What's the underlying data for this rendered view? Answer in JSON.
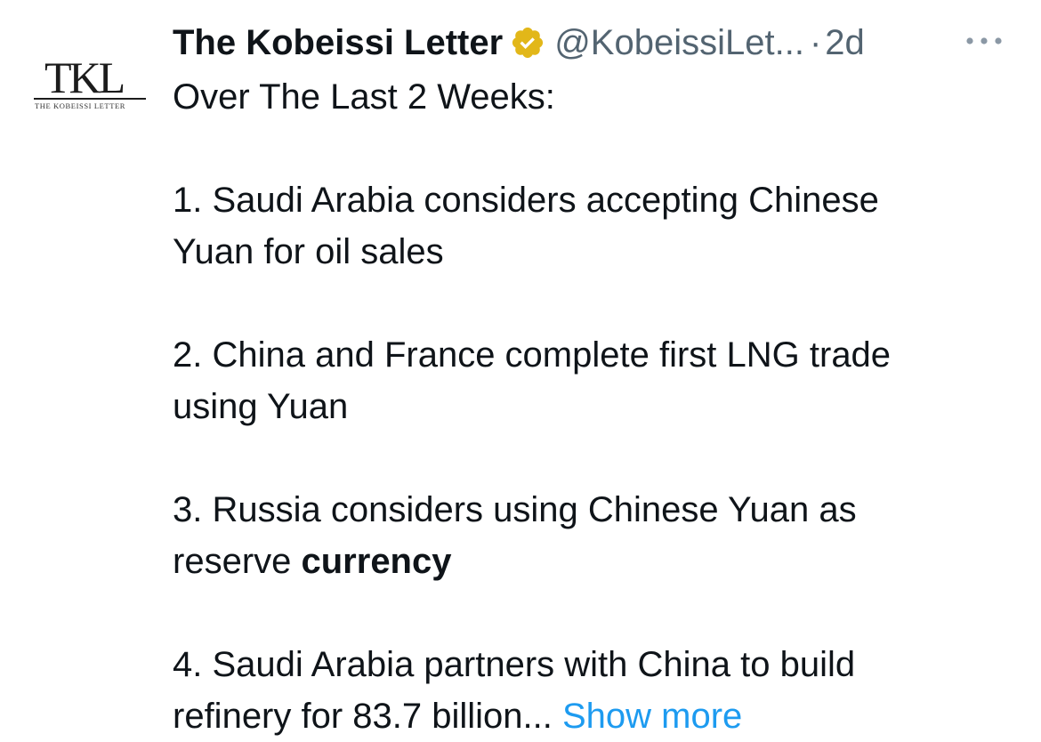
{
  "author": {
    "name": "The Kobeissi Letter",
    "handle": "@KobeissiLet...",
    "separator": "·",
    "time": "2d",
    "verified_badge_color": "#e2b719",
    "avatar": {
      "monogram": "TKL",
      "caption": "THE KOBEISSI LETTER"
    }
  },
  "more_icon": "more-horizontal-icon",
  "body": {
    "intro": "Over The Last 2 Weeks:",
    "items": [
      {
        "line1": "1. Saudi Arabia considers accepting Chinese",
        "line2": "Yuan for oil sales"
      },
      {
        "line1": "2. China and France complete first LNG trade",
        "line2": "using Yuan"
      },
      {
        "line1": "3. Russia considers using Chinese Yuan as",
        "line2_prefix": "reserve ",
        "line2_bold": "currency"
      },
      {
        "line1": "4. Saudi Arabia partners with China to build",
        "line2": "refinery for 83.7 billion..."
      }
    ],
    "show_more": "Show more"
  },
  "colors": {
    "text": "#0f1419",
    "secondary": "#536471",
    "link": "#1d9bf0"
  }
}
